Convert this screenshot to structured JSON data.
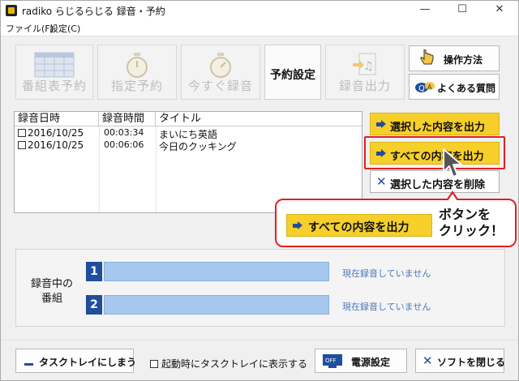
{
  "window": {
    "title": "radiko らじるらじる 録音・予約",
    "minimize_glyph": "—",
    "maximize_glyph": "☐",
    "close_glyph": "✕"
  },
  "menu": [
    "ファイル(F)",
    "設定(C)"
  ],
  "toolbar": {
    "buttons": [
      {
        "label": "番組表予約",
        "icon": "program-guide-icon",
        "enabled": false
      },
      {
        "label": "指定予約",
        "icon": "timer-icon",
        "enabled": false
      },
      {
        "label": "今すぐ録音",
        "icon": "stopwatch-icon",
        "enabled": false
      },
      {
        "label": "予約設定",
        "icon": "",
        "enabled": true
      },
      {
        "label": "録音出力",
        "icon": "music-file-icon",
        "enabled": false
      }
    ],
    "help": [
      {
        "label": "操作方法",
        "icon": "pointing-hand-icon"
      },
      {
        "label": "よくある質問",
        "icon": "question-bubble-icon"
      }
    ]
  },
  "recordings": {
    "columns": [
      "録音日時",
      "録音時間",
      "タイトル"
    ],
    "rows": [
      {
        "date": "2016/10/25",
        "duration": "00:03:34",
        "title": "まいにち英語"
      },
      {
        "date": "2016/10/25",
        "duration": "00:06:06",
        "title": "今日のクッキング"
      }
    ]
  },
  "actions": {
    "export_selected": "選択した内容を出力",
    "export_all": "すべての内容を出力",
    "delete_selected": "選択した内容を削除"
  },
  "callout": {
    "button_label": "すべての内容を出力",
    "text_line1": "ボタンを",
    "text_line2": "クリック！"
  },
  "recording_now": {
    "label_line1": "録音中の",
    "label_line2": "番組",
    "slots": [
      {
        "number": "1",
        "status": "現在録音していません"
      },
      {
        "number": "2",
        "status": "現在録音していません"
      }
    ]
  },
  "bottom": {
    "to_tray": "タスクトレイにしまう",
    "startup_tray": "起動時にタスクトレイに表示する",
    "power": "電源設定",
    "power_icon_text": "OFF",
    "close_app": "ソフトを閉じる"
  },
  "colors": {
    "accent_yellow": "#f7cf2a",
    "highlight_red": "#e02020",
    "brand_blue": "#1f4e9c",
    "progress_blue": "#a6c8ef"
  }
}
